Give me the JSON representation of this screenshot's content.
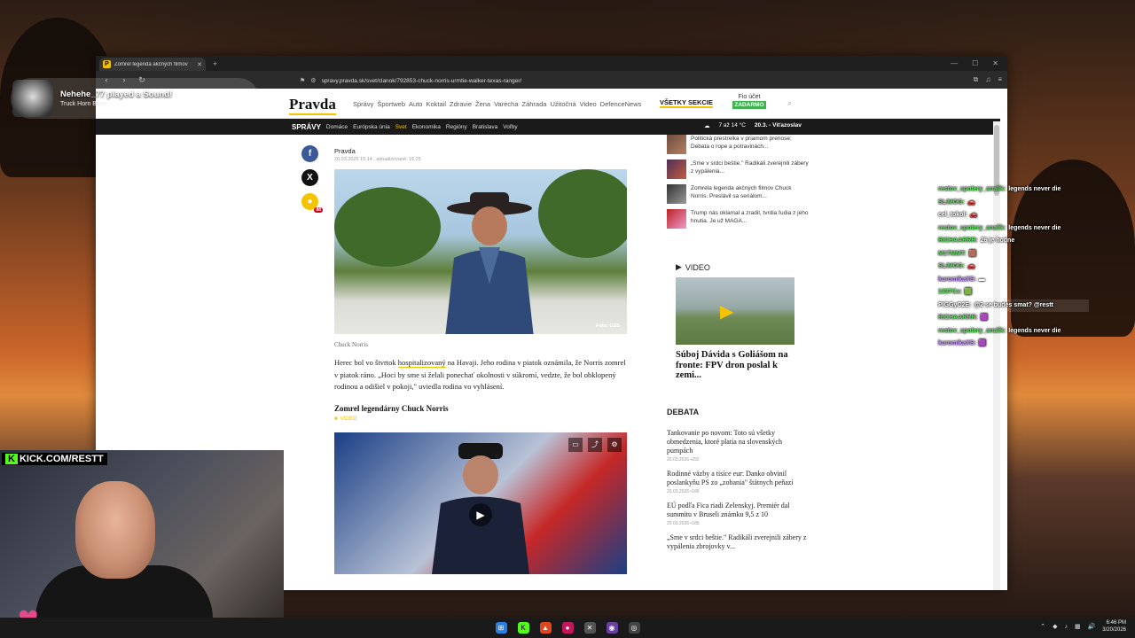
{
  "browser": {
    "tab_title": "Zomrel legenda akčných filmov",
    "tab_favicon": "P",
    "url": "spravy.pravda.sk/svet/clanok/792853-chuck-norris-urmtie-walker-texas-ranger/"
  },
  "site": {
    "logo": "Pravda",
    "nav": [
      "Správy",
      "Športweb",
      "Auto",
      "Koktail",
      "Zdravie",
      "Žena",
      "Varecha",
      "Záhrada",
      "Užitočná",
      "Video",
      "DefenceNews"
    ],
    "all_sections": "VŠETKY SEKCIE",
    "fio_top": "Fio účet",
    "fio_badge": "ZADARMO",
    "subnav_section": "SPRÁVY",
    "subnav": [
      "Domáce",
      "Európska únia",
      "Svet",
      "Ekonomika",
      "Regióny",
      "Bratislava",
      "Voľby"
    ],
    "weather": "7 až 14 °C",
    "nameday": "20.3. - Víťazoslav"
  },
  "article": {
    "author": "Pravda",
    "date": "20.03.2026 15:14 , aktualizované: 16:25",
    "photo_credit": "Foto: CBS",
    "caption": "Chuck Norris",
    "body_before": "Herec bol vo štvrtok ",
    "body_link": "hospitalizovaný",
    "body_after": " na Havaji. Jeho rodina v piatok oznámila, že Norris zomrel v piatok ráno. „Hoci by sme si želali ponechať okolnosti v súkromí, vedzte, že bol obklopený rodinou a odišiel v pokoji,\" uviedla rodina vo vyhlásení.",
    "subheading": "Zomrel legendárny Chuck Norris",
    "video_tag": "VIDEO",
    "comment_count": "88"
  },
  "sidebar": {
    "items": [
      {
        "text": "Politická prestrelka v priamom prenose: Debata o rope a potravinách..."
      },
      {
        "text": "„Sme v srdci beštie.\" Radikáli zverejnili zábery z vypálenia..."
      },
      {
        "text": "Zomrela legenda akčných filmov Chuck Norris. Preslávil sa seriálom..."
      },
      {
        "text": "Trump nás oklamal a zradil, tvrdia ľudia z jeho hnutia. Je už MAGA..."
      }
    ],
    "video_heading": "VIDEO",
    "video_title": "Súboj Dávida s Goliášom na fronte: FPV dron poslal k zemi...",
    "debate_heading": "DEBATA",
    "debates": [
      {
        "title": "Tankovanie po novom: Toto sú všetky obmedzenia, ktoré platia na slovenských pumpách",
        "date": "20.03.2026",
        "count": "292"
      },
      {
        "title": "Rodinné väzby a tisíce eur: Danko obvinil poslankyňu PS zo „zobania\" štátnych peňazí",
        "date": "20.03.2026",
        "count": "186"
      },
      {
        "title": "EÚ podľa Fica riadi Zelenskyj. Premiér dal summitu v Bruseli známku 9,5 z 10",
        "date": "20.03.2026",
        "count": "185"
      },
      {
        "title": "„Sme v srdci beštie.\" Radikáli zverejnili zábery z vypálenia zbrojovky v...",
        "date": "",
        "count": ""
      }
    ]
  },
  "overlay": {
    "notif_title": "Nehehe_77 played a Sound!",
    "notif_sub": "Truck Horn Blare",
    "kick_label": "KICK.COM/RESTT",
    "chat": [
      {
        "user": "restov_spotery_analik:",
        "msg": "legends never die"
      },
      {
        "user": "SLIMOG:",
        "msg": "🚗"
      },
      {
        "user": "cel_tokol:",
        "msg": "🚗"
      },
      {
        "user": "restov_spotery_analik:",
        "msg": "legends never die"
      },
      {
        "user": "RICHAARRR:",
        "msg": "26 je hodne"
      },
      {
        "user": "M1TMMT:",
        "msg": "🟫"
      },
      {
        "user": "SLIMOG:",
        "msg": "🚗"
      },
      {
        "user": "kuromikaXS:",
        "msg": "▬"
      },
      {
        "user": "1337Cx:",
        "msg": "🟩"
      },
      {
        "user": "PIGGyC2E:",
        "msg": "@2 se budes smat? @restt"
      },
      {
        "user": "RICHAARRR:",
        "msg": "🟪"
      },
      {
        "user": "restov_spotery_analik:",
        "msg": "legends never die"
      },
      {
        "user": "kuromikaXS:",
        "msg": "🟪"
      }
    ]
  },
  "taskbar": {
    "time": "6:46 PM",
    "date": "3/20/2026"
  }
}
